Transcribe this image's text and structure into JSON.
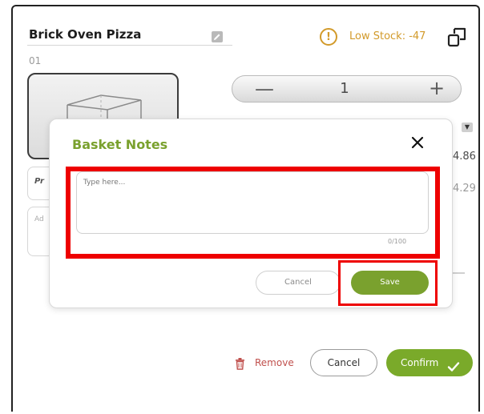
{
  "product": {
    "title": "Brick Oven Pizza",
    "code": "01",
    "stock_label": "Low Stock: -47",
    "warning_glyph": "!"
  },
  "quantity": {
    "minus": "—",
    "value": "1",
    "plus": "+"
  },
  "prices": {
    "line_1": "4.86",
    "line_2": "4.29"
  },
  "background_fields": {
    "field_1_placeholder": "Pr",
    "field_2_placeholder": "Ad"
  },
  "actions": {
    "remove_label": "Remove",
    "cancel_label": "Cancel",
    "confirm_label": "Confirm"
  },
  "modal": {
    "title": "Basket Notes",
    "textarea_placeholder": "Type here...",
    "char_count": "0/100",
    "cancel_label": "Cancel",
    "save_label": "Save"
  },
  "colors": {
    "accent_green": "#7aa12e",
    "warning_amber": "#d29a2a",
    "danger_red": "#c0504d",
    "highlight_red": "#ee0000"
  }
}
